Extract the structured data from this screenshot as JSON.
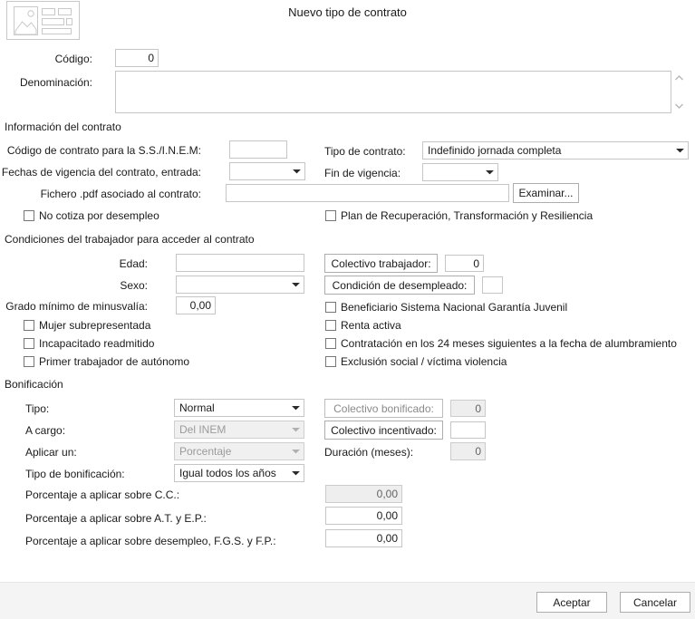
{
  "window": {
    "title": "Nuevo tipo de contrato",
    "thumbnail_icon": "image-placeholder-icon"
  },
  "top": {
    "codigo_label": "Código:",
    "codigo_value": "0",
    "denominacion_label": "Denominación:",
    "denominacion_value": "",
    "scroll_up_icon": "chevron-up-icon",
    "scroll_down_icon": "chevron-down-icon"
  },
  "contract_info": {
    "section_title": "Información del contrato",
    "codigo_ss_label": "Código de contrato para la S.S./I.N.E.M:",
    "codigo_ss_value": "",
    "fechas_vigencia_label": "Fechas de vigencia del contrato, entrada:",
    "fechas_vigencia_value": "",
    "fichero_label": "Fichero .pdf asociado al contrato:",
    "fichero_value": "",
    "examinar_label": "Examinar...",
    "tipo_contrato_label": "Tipo de contrato:",
    "tipo_contrato_value": "Indefinido jornada completa",
    "fin_vigencia_label": "Fin de vigencia:",
    "fin_vigencia_value": "",
    "no_cotiza_label": "No cotiza por desempleo",
    "no_cotiza_checked": false,
    "plan_recuperacion_label": "Plan de Recuperación, Transformación y Resiliencia",
    "plan_recuperacion_checked": false
  },
  "worker_conditions": {
    "section_title": "Condiciones del trabajador para acceder al contrato",
    "edad_label": "Edad:",
    "edad_value": "",
    "sexo_label": "Sexo:",
    "sexo_value": "",
    "grado_label": "Grado mínimo de minusvalía:",
    "grado_value": "0,00",
    "mujer_label": "Mujer subrepresentada",
    "mujer_checked": false,
    "incapacitado_label": "Incapacitado readmitido",
    "incapacitado_checked": false,
    "primer_trabajador_label": "Primer trabajador de autónomo",
    "primer_trabajador_checked": false,
    "colectivo_trabajador_label": "Colectivo trabajador:",
    "colectivo_trabajador_value": "0",
    "condicion_desempleado_label": "Condición de desempleado:",
    "condicion_desempleado_value": "",
    "beneficiario_label": "Beneficiario Sistema Nacional Garantía Juvenil",
    "beneficiario_checked": false,
    "renta_activa_label": "Renta activa",
    "renta_activa_checked": false,
    "contratacion_24_label": "Contratación en los 24 meses siguientes a la fecha de alumbramiento",
    "contratacion_24_checked": false,
    "exclusion_label": "Exclusión social  / víctima violencia",
    "exclusion_checked": false
  },
  "bonificacion": {
    "section_title": "Bonificación",
    "tipo_label": "Tipo:",
    "tipo_value": "Normal",
    "a_cargo_label": "A cargo:",
    "a_cargo_value": "Del INEM",
    "aplicar_un_label": "Aplicar un:",
    "aplicar_un_value": "Porcentaje",
    "tipo_bonificacion_label": "Tipo de bonificación:",
    "tipo_bonificacion_value": "Igual todos los años",
    "colectivo_bonificado_label": "Colectivo bonificado:",
    "colectivo_bonificado_value": "0",
    "colectivo_incentivado_label": "Colectivo incentivado:",
    "colectivo_incentivado_value": "",
    "duracion_label": "Duración (meses):",
    "duracion_value": "0",
    "porcentaje_cc_label": "Porcentaje a aplicar sobre C.C.:",
    "porcentaje_cc_value": "0,00",
    "porcentaje_at_label": "Porcentaje a aplicar sobre A.T. y E.P.:",
    "porcentaje_at_value": "0,00",
    "porcentaje_desempleo_label": "Porcentaje a aplicar sobre desempleo, F.G.S. y F.P.:",
    "porcentaje_desempleo_value": "0,00"
  },
  "footer": {
    "accept_label": "Aceptar",
    "cancel_label": "Cancelar"
  },
  "colors": {
    "window_bg": "#ffffff",
    "footer_bg": "#f4f4f4",
    "field_border": "#c5c5c5",
    "disabled_bg": "#eeeeee",
    "disabled_text": "#646464",
    "text": "#1a1a1a"
  }
}
